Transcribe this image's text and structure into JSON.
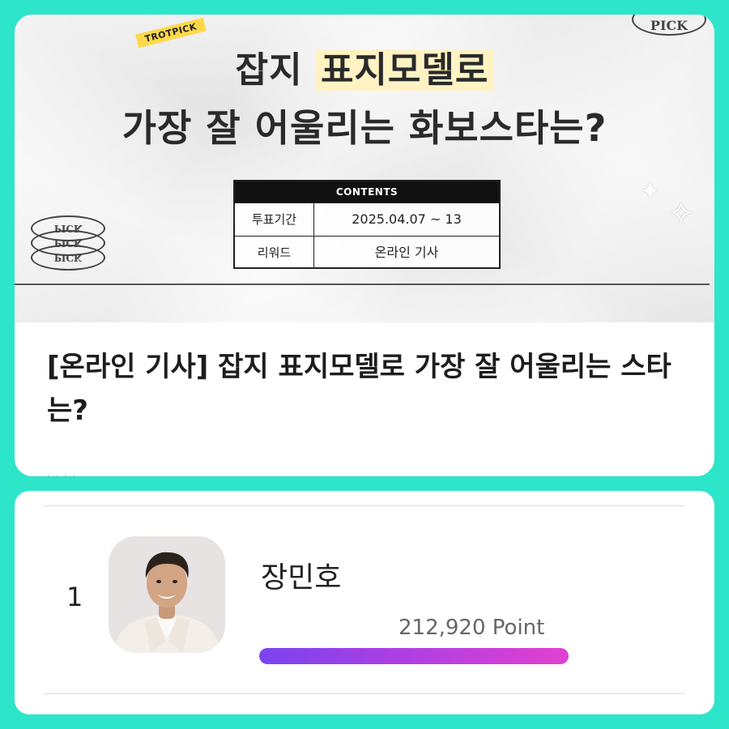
{
  "banner": {
    "tag": "TROTPICK",
    "stamp_text": "PICK",
    "title_line1_prefix": "잡지 ",
    "title_line1_highlight": "표지모델로",
    "title_line2": "가장 잘 어울리는 화보스타는?",
    "table": {
      "header": "CONTENTS",
      "rows": [
        {
          "key": "투표기간",
          "value": "2025.04.07 ~ 13"
        },
        {
          "key": "리워드",
          "value": "온라인 기사"
        }
      ]
    }
  },
  "article": {
    "title": "[온라인 기사] 잡지 표지모델로 가장 잘 어울리는 스타는?"
  },
  "ranking": [
    {
      "rank": "1",
      "name": "장민호",
      "points": "212,920 Point",
      "progress_percent": 100
    }
  ],
  "colors": {
    "background": "#2de5c9",
    "card": "#ffffff",
    "bar_start": "#7b43ef",
    "bar_end": "#e241d0",
    "highlight": "#fff3c4"
  }
}
